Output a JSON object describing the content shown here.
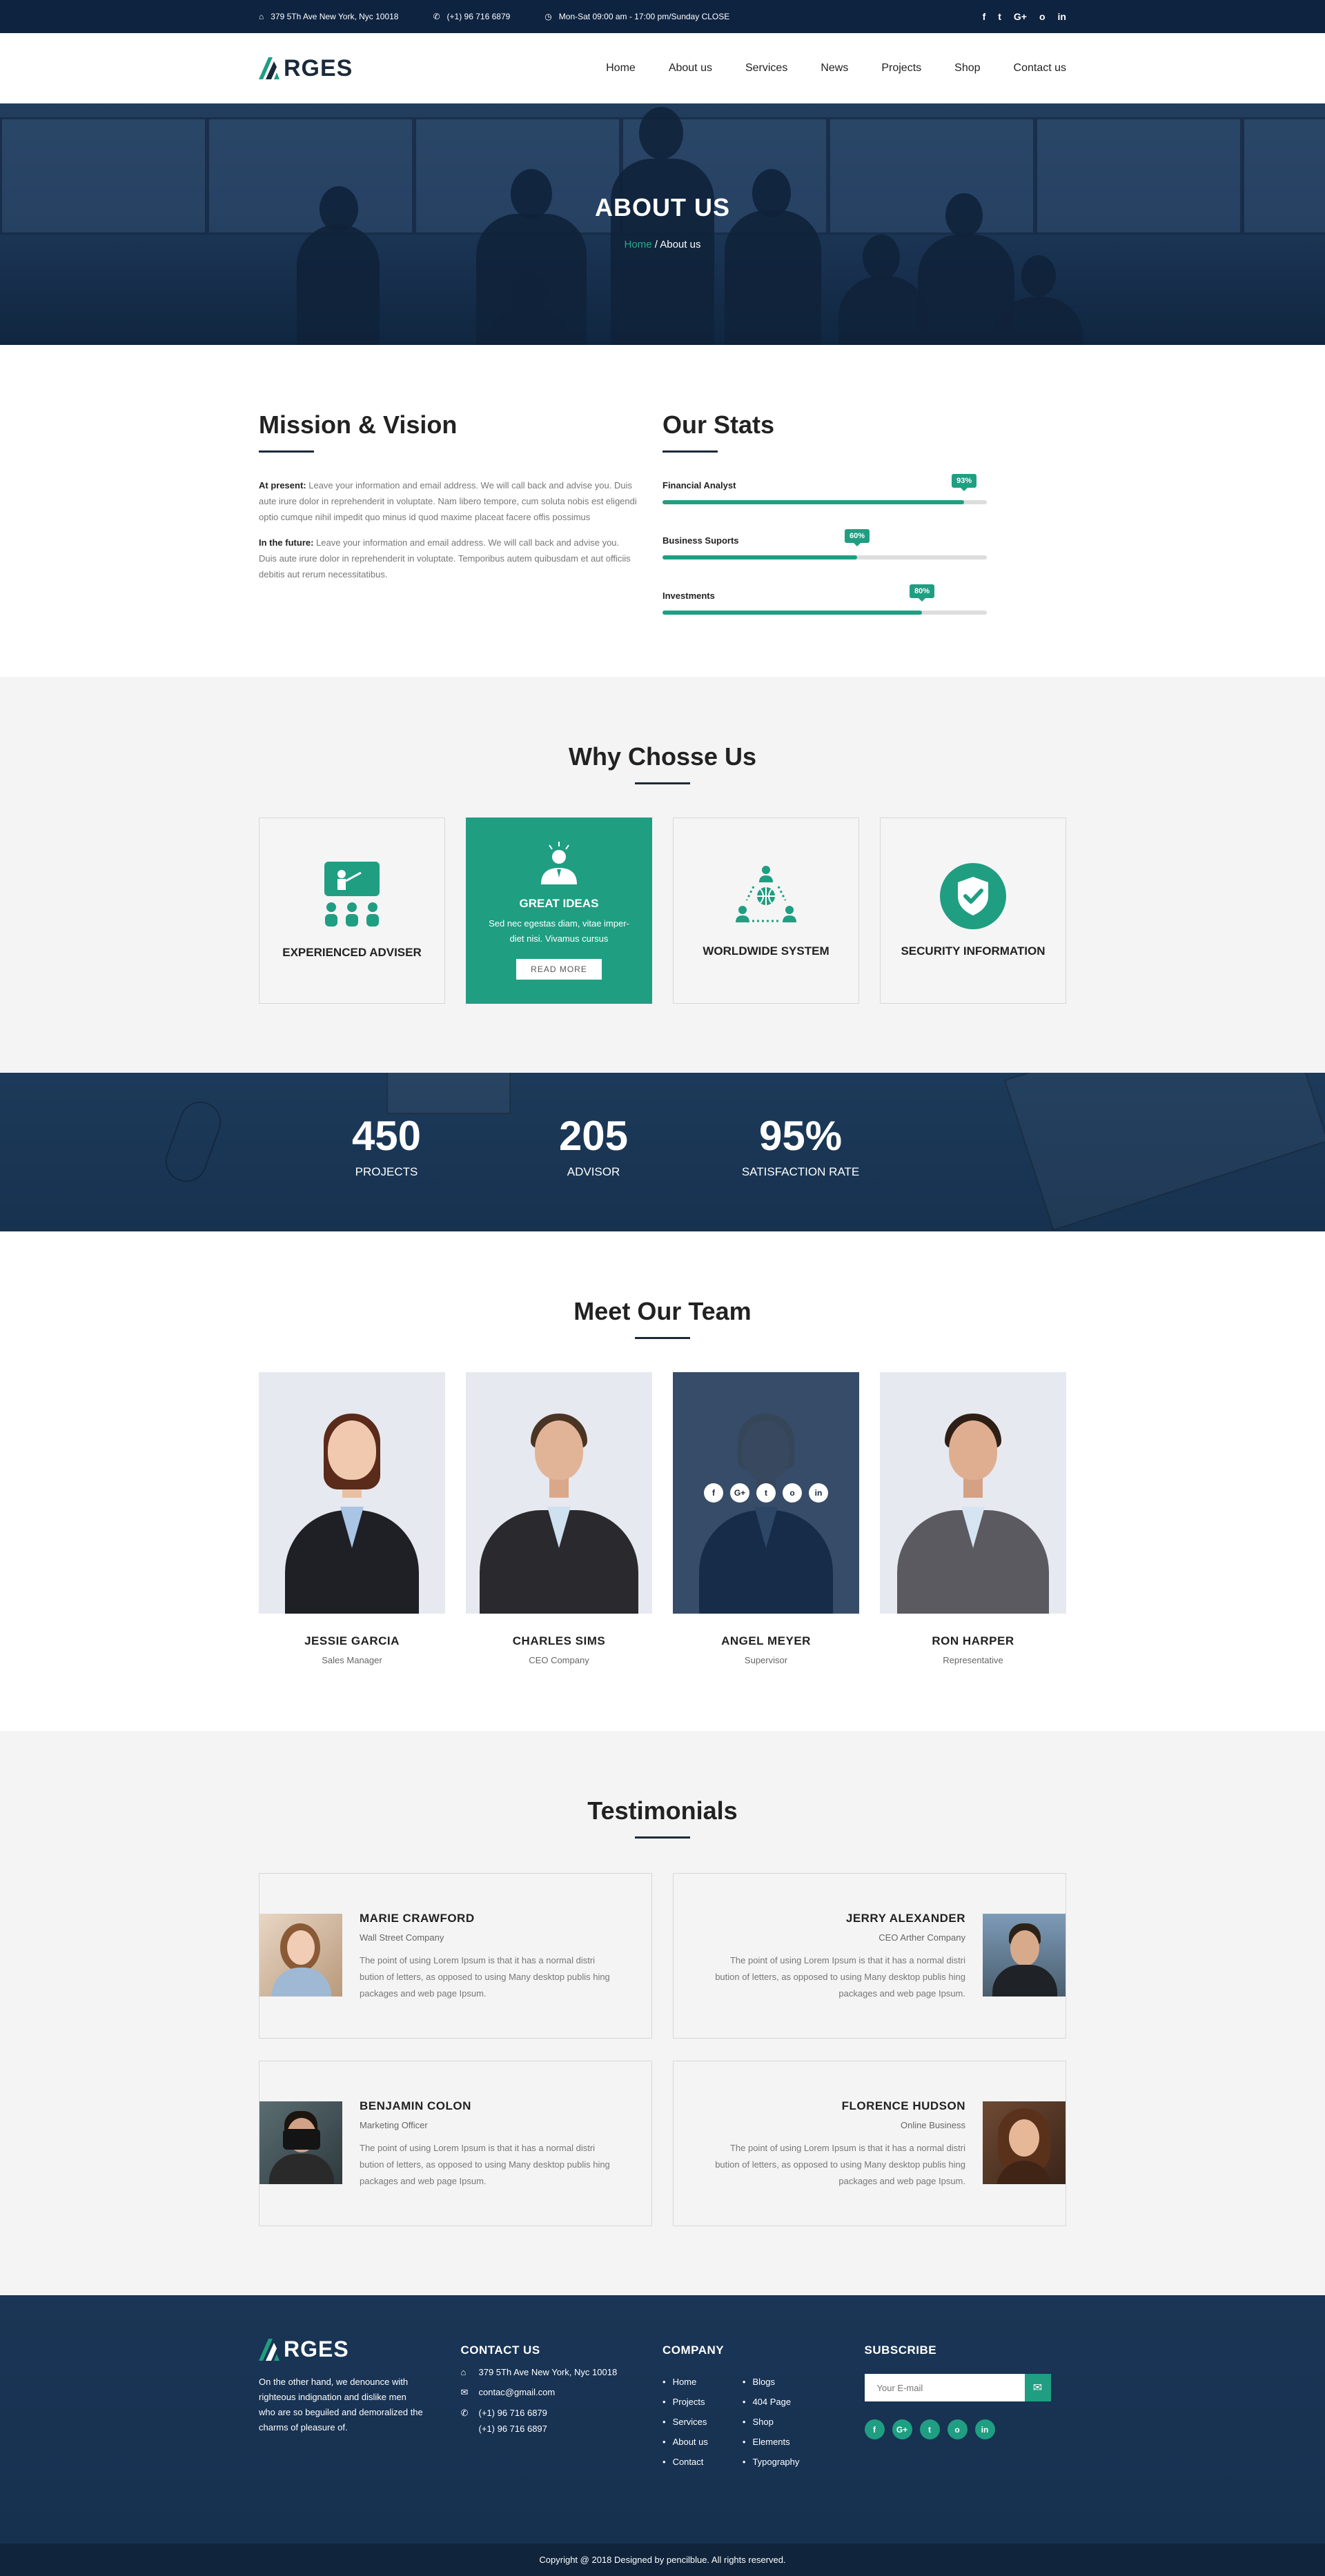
{
  "topbar": {
    "address": "379 5Th Ave New York, Nyc 10018",
    "phone": "(+1) 96 716 6879",
    "hours": "Mon-Sat 09:00 am - 17:00 pm/Sunday CLOSE",
    "social": [
      "f",
      "t",
      "G+",
      "o",
      "in"
    ]
  },
  "header": {
    "logo": "RGES",
    "nav": [
      "Home",
      "About us",
      "Services",
      "News",
      "Projects",
      "Shop",
      "Contact us"
    ]
  },
  "hero": {
    "title": "ABOUT US",
    "crumb_home": "Home",
    "crumb_sep": " / ",
    "crumb_current": "About us"
  },
  "mission": {
    "title": "Mission & Vision",
    "p1_label": "At present:",
    "p1_text": " Leave your information and email address. We will call back and advise you. Duis aute irure dolor in reprehenderit in voluptate. Nam libero tempore, cum soluta nobis est eligendi optio cumque nihil impedit quo minus id quod maxime placeat facere offis possimus",
    "p2_label": "In the future:",
    "p2_text": " Leave your information and email address. We will call back and advise you. Duis aute irure dolor in reprehenderit in voluptate. Temporibus autem quibusdam et aut officiis debitis aut rerum necessitatibus."
  },
  "stats": {
    "title": "Our Stats",
    "items": [
      {
        "label": "Financial Analyst",
        "value": 93,
        "display": "93%"
      },
      {
        "label": "Business Suports",
        "value": 60,
        "display": "60%"
      },
      {
        "label": "Investments",
        "value": 80,
        "display": "80%"
      }
    ]
  },
  "why": {
    "title": "Why Chosse Us",
    "cards": [
      {
        "title": "EXPERIENCED ADVISER",
        "icon": "presentation-icon"
      },
      {
        "title": "GREAT IDEAS",
        "icon": "idea-person-icon",
        "desc": "Sed nec egestas diam, vitae imper-diet nisi. Vivamus cursus",
        "button": "READ MORE"
      },
      {
        "title": "WORLDWIDE SYSTEM",
        "icon": "network-globe-icon"
      },
      {
        "title": "SECURITY INFORMATION",
        "icon": "shield-check-icon"
      }
    ]
  },
  "counters": [
    {
      "num": "450",
      "label": "PROJECTS"
    },
    {
      "num": "205",
      "label": "ADVISOR"
    },
    {
      "num": "95%",
      "label": "SATISFACTION RATE"
    }
  ],
  "team": {
    "title": "Meet Our Team",
    "members": [
      {
        "name": "JESSIE GARCIA",
        "role": "Sales Manager"
      },
      {
        "name": "CHARLES SIMS",
        "role": "CEO Company"
      },
      {
        "name": "ANGEL MEYER",
        "role": "Supervisor"
      },
      {
        "name": "RON HARPER",
        "role": "Representative"
      }
    ],
    "overlay_social": [
      "f",
      "G+",
      "t",
      "o",
      "in"
    ]
  },
  "testimonials": {
    "title": "Testimonials",
    "items": [
      {
        "name": "MARIE CRAWFORD",
        "company": "Wall Street Company",
        "quote": "The point of using Lorem Ipsum is that it has a normal distri bution of letters, as opposed to using Many desktop publis hing packages and web page Ipsum."
      },
      {
        "name": "JERRY ALEXANDER",
        "company": "CEO Arther Company",
        "quote": "The point of using Lorem Ipsum is that it has a normal distri bution of letters, as opposed to using Many desktop publis hing packages and web page Ipsum."
      },
      {
        "name": "BENJAMIN COLON",
        "company": "Marketing Officer",
        "quote": "The point of using Lorem Ipsum is that it has a normal distri bution of letters, as opposed to using Many desktop publis hing packages and web page Ipsum."
      },
      {
        "name": "FLORENCE HUDSON",
        "company": "Online Business",
        "quote": "The point of using Lorem Ipsum is that it has a normal distri bution of letters, as opposed to using Many desktop publis hing packages and web page Ipsum."
      }
    ]
  },
  "footer": {
    "logo": "RGES",
    "about": "On the other hand, we denounce with righteous indignation and dislike men who are so beguiled and demoralized the charms of pleasure of.",
    "contact_title": "CONTACT US",
    "contact_address": "379 5Th Ave New York, Nyc 10018",
    "contact_email": "contac@gmail.com",
    "contact_phone1": "(+1) 96 716 6879",
    "contact_phone2": "(+1) 96 716 6897",
    "company_title": "COMPANY",
    "links_col1": [
      "Home",
      "Projects",
      "Services",
      "About us",
      "Contact"
    ],
    "links_col2": [
      "Blogs",
      "404 Page",
      "Shop",
      "Elements",
      "Typography"
    ],
    "subscribe_title": "SUBSCRIBE",
    "subscribe_placeholder": "Your E-mail",
    "social": [
      "f",
      "G+",
      "t",
      "o",
      "in"
    ],
    "copyright": "Copyright @ 2018 Designed by pencilblue. All rights reserved."
  },
  "colors": {
    "accent": "#1f9e82",
    "navy": "#0e2340",
    "text": "#333333"
  }
}
